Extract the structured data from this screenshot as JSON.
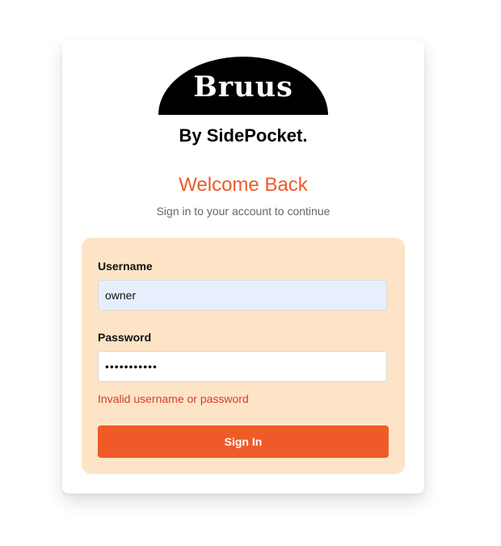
{
  "brand": {
    "logo_text": "Bruus",
    "subtitle": "By SidePocket."
  },
  "header": {
    "title": "Welcome Back",
    "subtitle": "Sign in to your account to continue"
  },
  "form": {
    "username_label": "Username",
    "username_value": "owner",
    "password_label": "Password",
    "password_value": "•••••••••••",
    "error_message": "Invalid username or password",
    "submit_label": "Sign In"
  },
  "colors": {
    "accent": "#f05a28",
    "panel": "#fde4c6",
    "error": "#d63b2f",
    "username_fill": "#e8effc"
  }
}
